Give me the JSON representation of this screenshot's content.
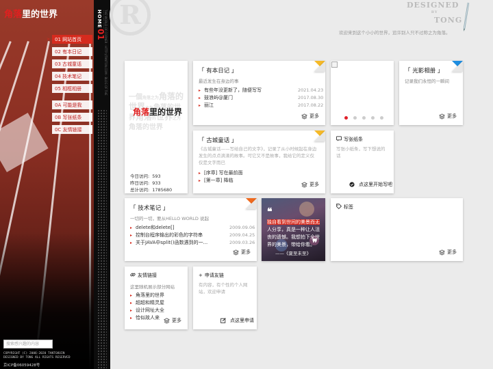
{
  "site": {
    "logo_part1": "角落",
    "logo_part2": "里的世界",
    "home_label": "HOME",
    "home_number": "01",
    "strip_text": "THE WORLD OF CORNER · HTTP://TANTON.COM · BLOG OF THE CORNER WORLD",
    "welcome": "欢迎来到这个小小的世界，追许别人只不过称之为角落。",
    "designed_top": "DESIGNED",
    "designed_by": "BY",
    "designed_bottom": "TONG",
    "watermark": "R"
  },
  "nav": {
    "items": [
      {
        "label": "01 网站首页",
        "active": true
      },
      {
        "label": "02 有本日记",
        "active": false
      },
      {
        "label": "03 古城童话",
        "active": false
      },
      {
        "label": "04 技术笔记",
        "active": false
      },
      {
        "label": "05 相框相册",
        "active": false
      },
      {
        "label": "0A 可能是我",
        "active": false
      },
      {
        "label": "0B 写张纸条",
        "active": false
      },
      {
        "label": "0C 友情链接",
        "active": false
      }
    ]
  },
  "search": {
    "placeholder": "搜索感兴趣的内容"
  },
  "footer": {
    "copyright1": "COPYRIGHT (C) 2006-2020 TANTGKUIN",
    "copyright2": "DESIGNED BY TONG ALL RIGHTS RESERVED",
    "icp": "京ICP备06059428号"
  },
  "stats_card": {
    "bigtext": [
      "一個",
      "角落",
      "之为",
      "角落",
      "的世界",
      "之为",
      "角落",
      "的世界",
      "角落",
      "的",
      "世界",
      "之为",
      "角落",
      "的世界"
    ],
    "logo_part1": "角落",
    "logo_part2": "里的世界",
    "today_label": "今日访问:",
    "today_value": "593",
    "yesterday_label": "昨日访问:",
    "yesterday_value": "933",
    "total_label": "总计访问:",
    "total_value": "1785680"
  },
  "diary_card": {
    "title": "「 有本日记 」",
    "subtitle": "最近发生在身边的事",
    "items": [
      {
        "text": "有些年没更新了，随便写写",
        "date": "2021.04.23"
      },
      {
        "text": "鼓浪屿@厦门",
        "date": "2017.08.30"
      },
      {
        "text": "丽江",
        "date": "2017.08.22"
      }
    ],
    "more": "更多",
    "accent": "#f5b928"
  },
  "slider": {
    "dots": 5,
    "active_dot": 0,
    "accent": "#e0202a"
  },
  "photo_card": {
    "title": "「 光影相册 」",
    "subtitle": "记录我们永恒的一瞬间",
    "more": "更多",
    "accent": "#1e8de0"
  },
  "fairy_card": {
    "title": "「 古城童话 」",
    "desc": "《古城童话——写给自己的文字》，记录了从小时候起在身边发生的点点滴滴的故事。可它又不是故事，我给它的定义仅仅是文字而已",
    "items": [
      {
        "text": "[序章] 写在最前面"
      },
      {
        "text": "[第一章] 降临"
      }
    ],
    "more": "更多"
  },
  "note_card": {
    "title": "写张纸条",
    "desc": "写张小纸条，写下想说的话",
    "action": "点这里开始写吧"
  },
  "tech_card": {
    "title": "「 技术笔记 」",
    "subtitle": "一切的一切，要从HELLO WORLD 说起",
    "items": [
      {
        "text": "delete和delete[]",
        "date": "2009.09.06"
      },
      {
        "text": "控制台程序输出的彩色的字符串",
        "date": "2009.04.25"
      },
      {
        "text": "关于JAVA中split()函数遇到的一...",
        "date": "2009.03.26"
      }
    ],
    "more": "更多",
    "accent": "#f06a1e"
  },
  "quote_card": {
    "lines": [
      "独自看到世间的美景而无",
      "人分享，真是一种让人沮",
      "丧的遗憾。我想拍下全世",
      "界的美景，带给你看。"
    ],
    "source": "——《夏至未至》"
  },
  "tags_card": {
    "title": "标签",
    "more": "更多"
  },
  "links_card": {
    "title": "友情链接",
    "subtitle": "这里随机展示部分网站",
    "items": [
      {
        "text": "角落里的世界"
      },
      {
        "text": "超超和精灵屋"
      },
      {
        "text": "设计网址大全"
      },
      {
        "text": "恰似故人来"
      }
    ],
    "more": "更多"
  },
  "apply_card": {
    "title": "申请友链",
    "desc": "有内容，有个性的个人网站，欢迎申请",
    "action": "点这里申请"
  }
}
